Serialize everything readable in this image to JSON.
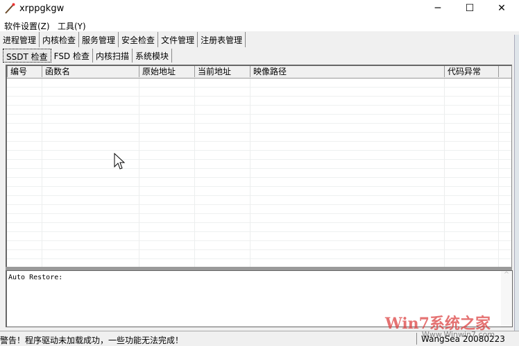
{
  "window": {
    "title": "xrppgkgw",
    "minimize": "─",
    "maximize": "☐",
    "close": "✕"
  },
  "menu": [
    "软件设置(Z)",
    "工具(Y)"
  ],
  "tabs": [
    "进程管理",
    "内核检查",
    "服务管理",
    "安全检查",
    "文件管理",
    "注册表管理"
  ],
  "active_tab": 1,
  "subtabs": [
    "SSDT 检查",
    "FSD 检查",
    "内核扫描",
    "系统模块"
  ],
  "table": {
    "columns": [
      "编号",
      "函数名",
      "原始地址",
      "当前地址",
      "映像路径",
      "代码异常"
    ],
    "rows": []
  },
  "log": {
    "text": "Auto Restore:",
    "scroll_up": "^"
  },
  "status": {
    "message": "警告！程序驱动未加载成功，一些功能无法完成！",
    "version": "WangSea 20080223"
  },
  "watermark": {
    "brand": "Win7系统之家",
    "url": "Www.Winwin7.com"
  }
}
